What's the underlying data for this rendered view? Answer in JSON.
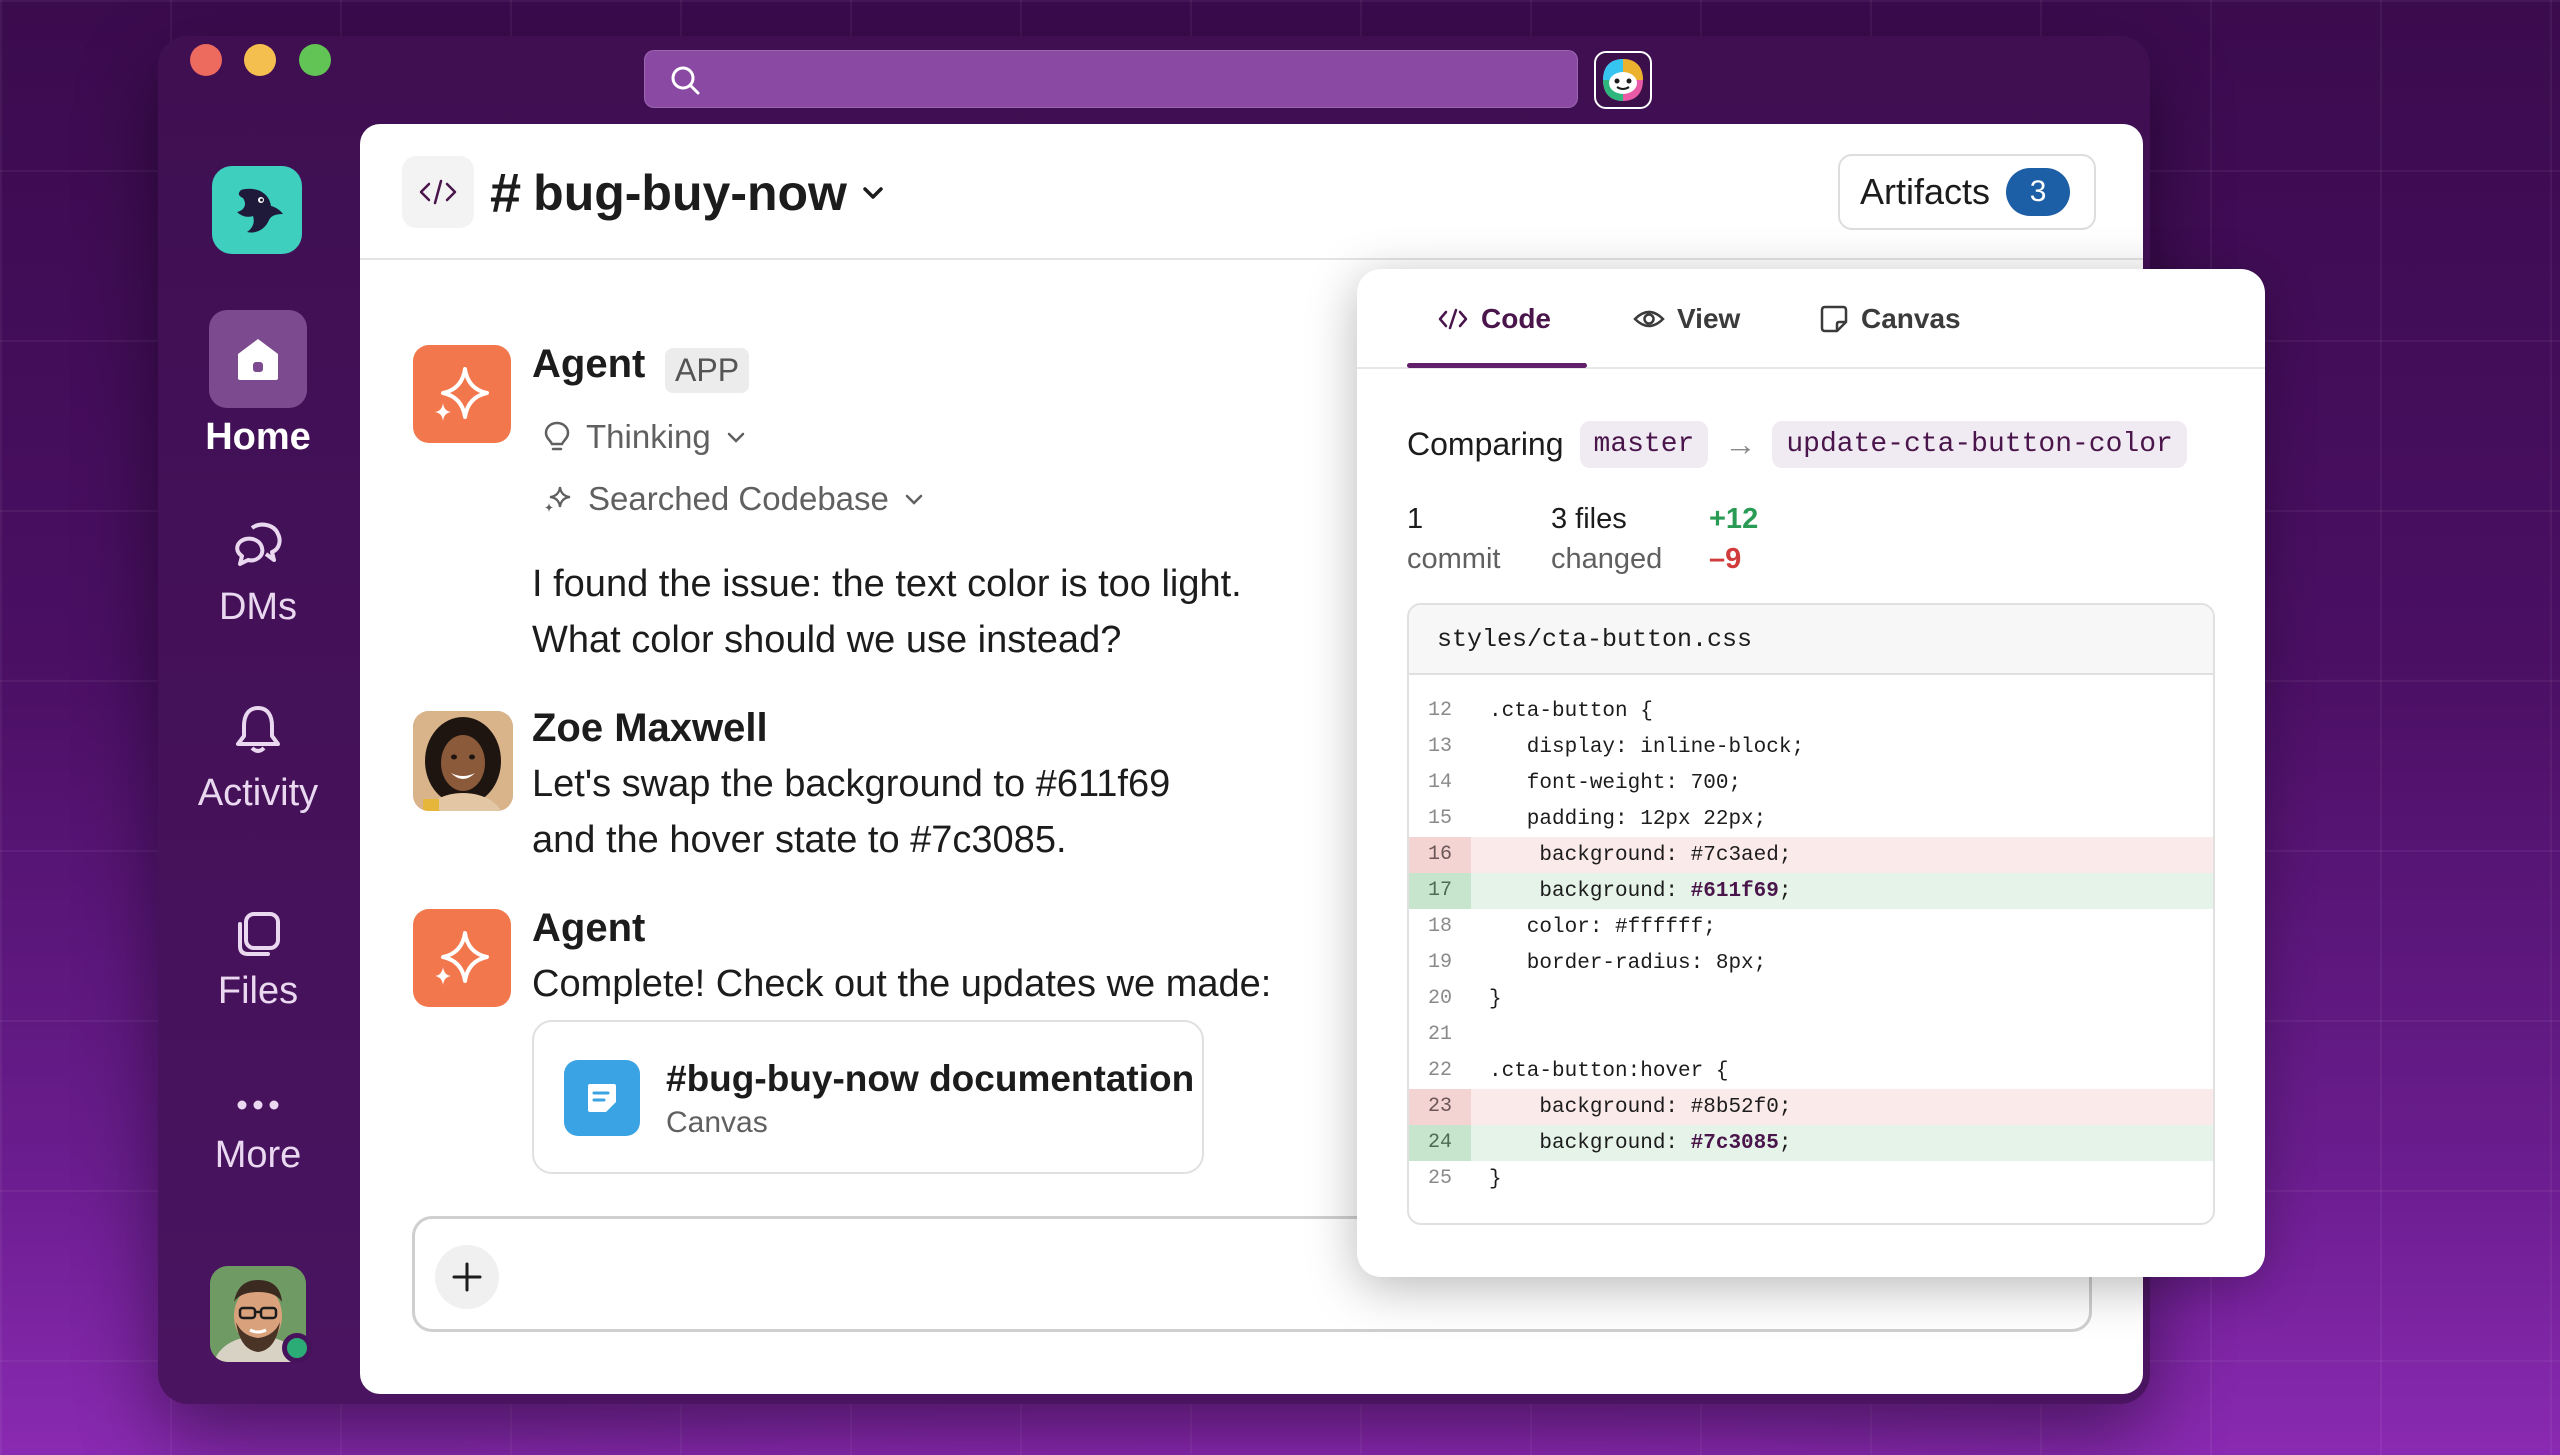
{
  "app": {
    "search": {
      "placeholder": ""
    },
    "colors": {
      "accent": "#611f69",
      "agent": "#f2774c",
      "add": "#2a9b55",
      "delete": "#d13b3b"
    }
  },
  "sidebar": {
    "items": [
      {
        "label": "Home",
        "icon": "home-icon",
        "active": true
      },
      {
        "label": "DMs",
        "icon": "dm-icon"
      },
      {
        "label": "Activity",
        "icon": "bell-icon"
      },
      {
        "label": "Files",
        "icon": "files-icon"
      },
      {
        "label": "More",
        "icon": "more-icon"
      }
    ]
  },
  "header": {
    "channel": "bug-buy-now",
    "artifacts_label": "Artifacts",
    "artifacts_count": "3"
  },
  "messages": [
    {
      "sender": "Agent",
      "badge": "APP",
      "steps": [
        "Thinking",
        "Searched Codebase"
      ],
      "lines": [
        "I found the issue: the text color is too light.",
        "What color should we use instead?"
      ]
    },
    {
      "sender": "Zoe Maxwell",
      "lines": [
        "Let's swap the background to #611f69",
        "and the hover state to #7c3085."
      ]
    },
    {
      "sender": "Agent",
      "lines": [
        "Complete! Check out the updates we made:"
      ],
      "attachment": {
        "title": "#bug-buy-now documentation",
        "type": "Canvas"
      }
    }
  ],
  "composer": {
    "placeholder": ""
  },
  "artifact_panel": {
    "tabs": [
      {
        "label": "Code",
        "active": true
      },
      {
        "label": "View"
      },
      {
        "label": "Canvas"
      }
    ],
    "comparing_label": "Comparing",
    "base_branch": "master",
    "head_branch": "update-cta-button-color",
    "stats": {
      "commits": "1",
      "commits_label": "commit",
      "files": "3 files",
      "files_label": "changed",
      "additions": "+12",
      "deletions": "–9"
    },
    "file": "styles/cta-button.css",
    "lines": [
      {
        "n": "12",
        "code": ".cta-button {",
        "type": "ctx"
      },
      {
        "n": "13",
        "code": "   display: inline-block;",
        "type": "ctx"
      },
      {
        "n": "14",
        "code": "   font-weight: 700;",
        "type": "ctx"
      },
      {
        "n": "15",
        "code": "   padding: 12px 22px;",
        "type": "ctx"
      },
      {
        "n": "16",
        "code": "    background: #7c3aed;",
        "type": "del"
      },
      {
        "n": "17",
        "code": "    background: ",
        "hl": "#611f69",
        "tail": ";",
        "type": "add"
      },
      {
        "n": "18",
        "code": "   color: #ffffff;",
        "type": "ctx"
      },
      {
        "n": "19",
        "code": "   border-radius: 8px;",
        "type": "ctx"
      },
      {
        "n": "20",
        "code": "}",
        "type": "ctx"
      },
      {
        "n": "21",
        "code": "",
        "type": "ctx"
      },
      {
        "n": "22",
        "code": ".cta-button:hover {",
        "type": "ctx"
      },
      {
        "n": "23",
        "code": "    background: #8b52f0;",
        "type": "del"
      },
      {
        "n": "24",
        "code": "    background: ",
        "hl": "#7c3085",
        "tail": ";",
        "type": "add"
      },
      {
        "n": "25",
        "code": "}",
        "type": "ctx"
      }
    ]
  }
}
